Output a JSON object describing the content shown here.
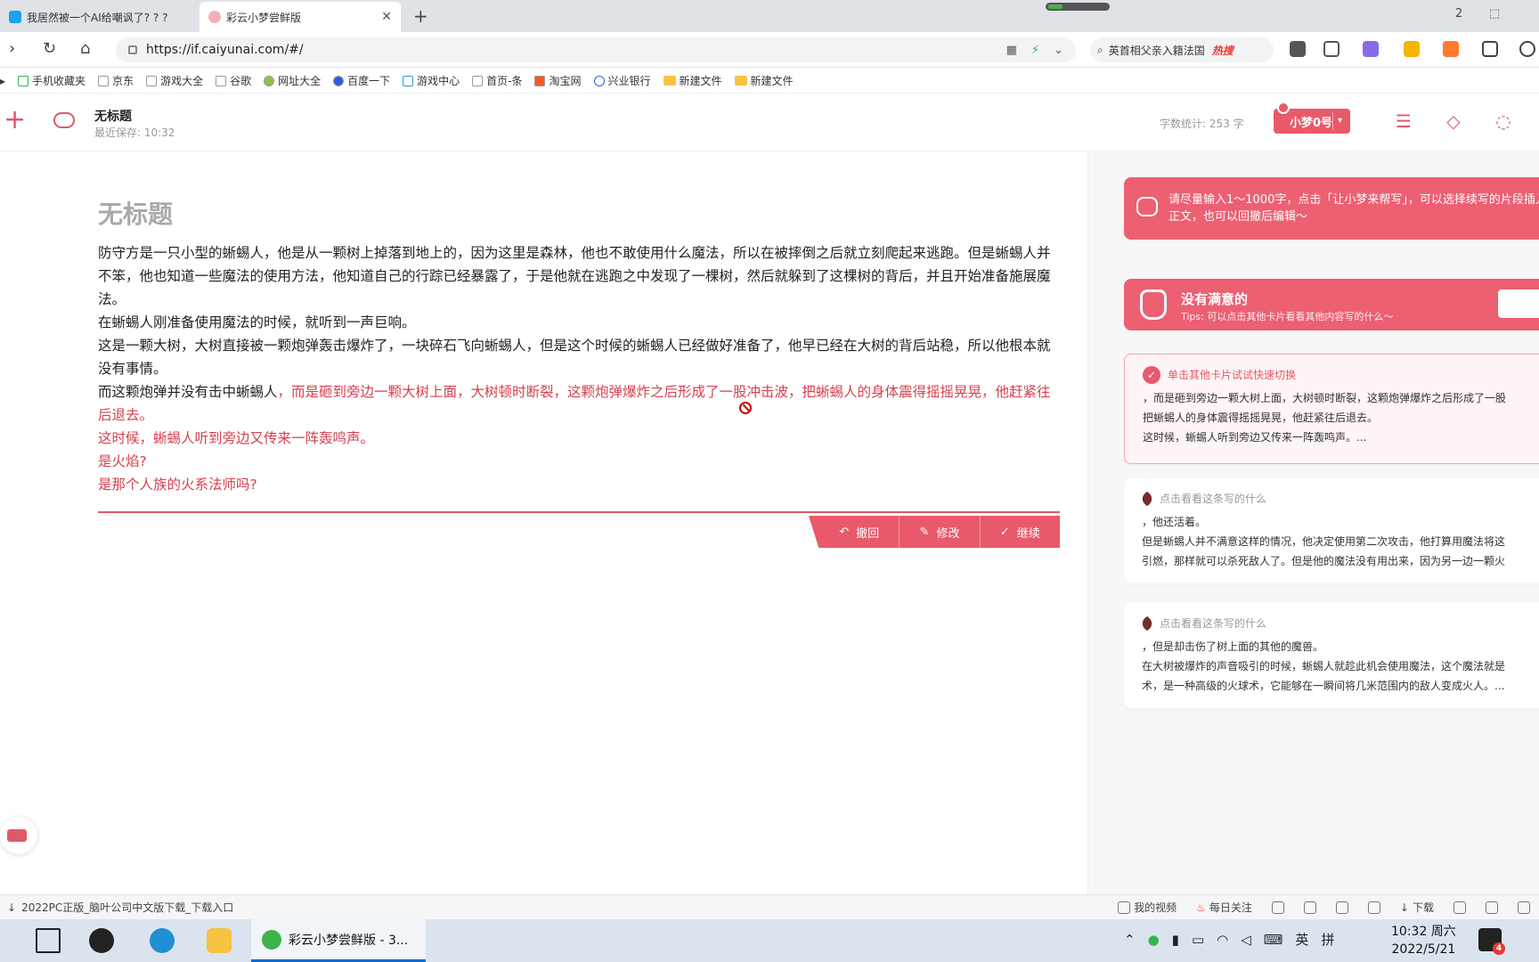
{
  "browser": {
    "tabs": [
      {
        "title": "我居然被一个AI给嘲讽了? ? ?"
      },
      {
        "title": "彩云小梦尝鲜版"
      }
    ],
    "url": "https://if.caiyunai.com/#/",
    "search_text": "英首相父亲入籍法国",
    "search_hot": "热搜",
    "bookmarks": [
      "手机收藏夹",
      "京东",
      "游戏大全",
      "谷歌",
      "网址大全",
      "百度一下",
      "游戏中心",
      "首页-条",
      "淘宝网",
      "兴业银行",
      "新建文件",
      "新建文件"
    ],
    "status_left": "2022PC正版_脑叶公司中文版下载_下载入口",
    "status_right": [
      "我的视频",
      "每日关注",
      "下载"
    ]
  },
  "app": {
    "doc_title": "无标题",
    "last_saved": "最近保存: 10:32",
    "word_count_label": "字数统计:",
    "word_count": "253 字",
    "model_label": "小梦0号"
  },
  "editor": {
    "heading": "无标题",
    "paragraphs": [
      {
        "text": "防守方是一只小型的蜥蜴人，他是从一颗树上掉落到地上的，因为这里是森林，他也不敢使用什么魔法，所以在被摔倒之后就立刻爬起来逃跑。但是蜥蜴人并不笨，他也知道一些魔法的使用方法，他知道自己的行踪已经暴露了，于是他就在逃跑之中发现了一棵树，然后就躲到了这棵树的背后，并且开始准备施展魔法。",
        "ai": ""
      },
      {
        "text": "在蜥蜴人刚准备使用魔法的时候，就听到一声巨响。",
        "ai": ""
      },
      {
        "text": "这是一颗大树，大树直接被一颗炮弹轰击爆炸了，一块碎石飞向蜥蜴人，但是这个时候的蜥蜴人已经做好准备了，他早已经在大树的背后站稳，所以他根本就没有事情。",
        "ai": ""
      },
      {
        "text": "而这颗炮弹并没有击中蜥蜴人",
        "ai": "，而是砸到旁边一颗大树上面，大树顿时断裂，这颗炮弹爆炸之后形成了一股冲击波，把蜥蜴人的身体震得摇摇晃晃，他赶紧往后退去。"
      },
      {
        "text": "",
        "ai": "这时候，蜥蜴人听到旁边又传来一阵轰鸣声。"
      },
      {
        "text": "",
        "ai": "是火焰?"
      },
      {
        "text": "",
        "ai": "是那个人族的火系法师吗?"
      }
    ],
    "actions": {
      "undo": "撤回",
      "edit": "修改",
      "continue": "继续"
    }
  },
  "panel": {
    "banner": "请尽量输入1～1000字，点击「让小梦来帮写」，可以选择续写的片段插入正文，也可以回撤后编辑～",
    "unsatisfied_title": "没有满意的",
    "unsatisfied_tip": "Tips: 可以点击其他卡片看看其他内容写的什么～",
    "cards": [
      {
        "header": "单击其他卡片试试快速切换",
        "lines": [
          "，而是砸到旁边一颗大树上面，大树顿时断裂，这颗炮弹爆炸之后形成了一股",
          "把蜥蜴人的身体震得摇摇晃晃，他赶紧往后退去。",
          "这时候，蜥蜴人听到旁边又传来一阵轰鸣声。..."
        ]
      },
      {
        "header": "点击看看这条写的什么",
        "lines": [
          "，他还活着。",
          "但是蜥蜴人并不满意这样的情况，他决定使用第二次攻击，他打算用魔法将这",
          "引燃，那样就可以杀死敌人了。但是他的魔法没有用出来，因为另一边一颗火"
        ]
      },
      {
        "header": "点击看看这条写的什么",
        "lines": [
          "，但是却击伤了树上面的其他的魔兽。",
          "在大树被爆炸的声音吸引的时候，蜥蜴人就趁此机会使用魔法，这个魔法就是",
          "术，是一种高级的火球术，它能够在一瞬间将几米范围内的敌人变成火人。..."
        ]
      }
    ]
  },
  "taskbar": {
    "active_app": "彩云小梦尝鲜版 - 3...",
    "ime_lang": "英",
    "ime_mode": "拼",
    "time": "10:32 周六",
    "date": "2022/5/21",
    "notification_count": "4"
  },
  "colors": {
    "accent": "#e8596b",
    "ai_text": "#d6404f"
  }
}
